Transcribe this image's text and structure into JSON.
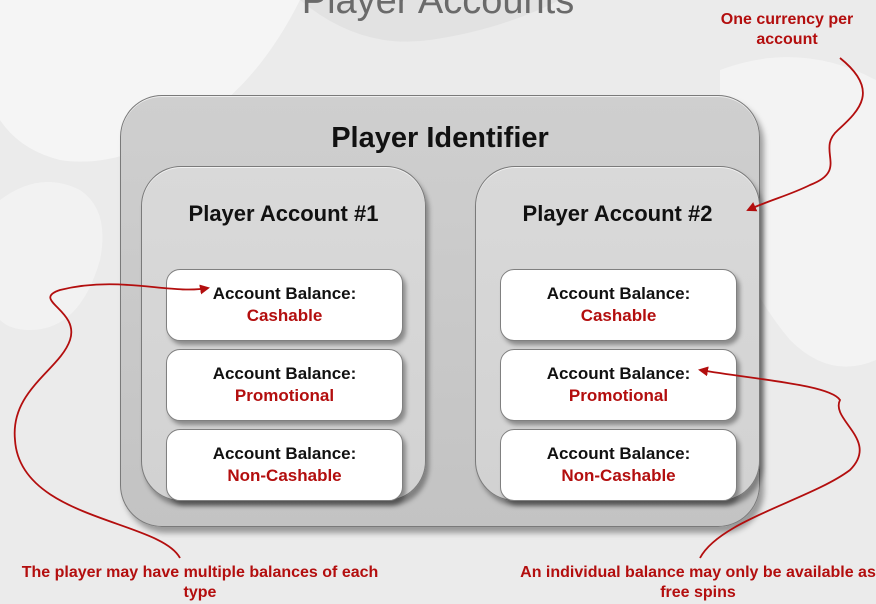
{
  "title": "Player Accounts",
  "outer": {
    "title": "Player Identifier"
  },
  "accounts": [
    {
      "title": "Player Account #1",
      "balances": [
        {
          "label": "Account Balance:",
          "type": "Cashable"
        },
        {
          "label": "Account Balance:",
          "type": "Promotional"
        },
        {
          "label": "Account Balance:",
          "type": "Non-Cashable"
        }
      ]
    },
    {
      "title": "Player Account #2",
      "balances": [
        {
          "label": "Account Balance:",
          "type": "Cashable"
        },
        {
          "label": "Account Balance:",
          "type": "Promotional"
        },
        {
          "label": "Account Balance:",
          "type": "Non-Cashable"
        }
      ]
    }
  ],
  "notes": {
    "currency": "One currency per account",
    "multiple": "The player may have multiple balances of each type",
    "freespins": "An individual balance may only be available as free spins"
  },
  "colors": {
    "accent": "#b30e0e",
    "background": "#ebebeb",
    "box": "#cfcfcf"
  }
}
